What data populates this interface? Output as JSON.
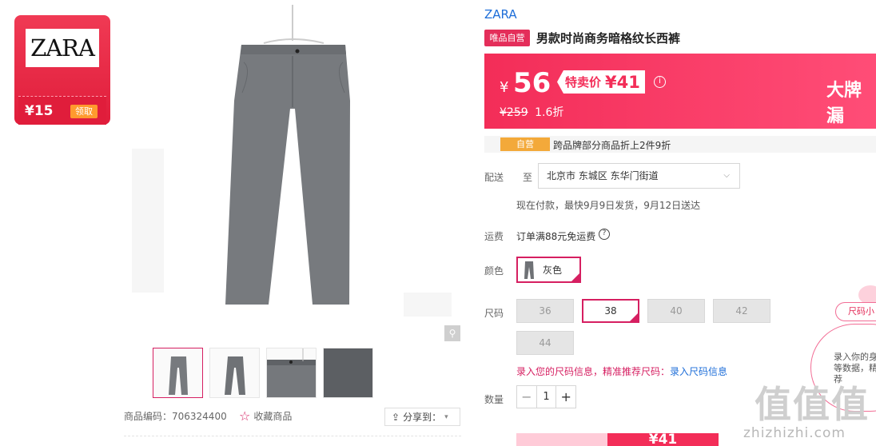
{
  "coupon": {
    "brand_logo": "ZARA",
    "amount": "¥15",
    "action": "领取"
  },
  "product": {
    "brand": "ZARA",
    "self_tag": "唯品自营",
    "title": "男款时尚商务暗格纹长西裤",
    "code_label": "商品编码：706324400",
    "favorite": "收藏商品",
    "share": "分享到：",
    "zoom_icon": "search-icon"
  },
  "price": {
    "currency": "¥",
    "value": "56",
    "special_label": "特卖价",
    "special_value": "¥41",
    "original": "¥259",
    "discount": "1.6折",
    "banner_text": "大牌漏"
  },
  "promo": {
    "tag": "自营",
    "text": "跨品牌部分商品折上2件9折"
  },
  "delivery": {
    "label": "配送",
    "to": "至",
    "address": "北京市 东城区 东华门街道",
    "estimate": "现在付款，最快9月9日发货，9月12日送达"
  },
  "shipping": {
    "label": "运费",
    "text": "订单满88元免运费"
  },
  "color": {
    "label": "颜色",
    "selected": "灰色"
  },
  "size": {
    "label": "尺码",
    "options": [
      "36",
      "38",
      "40",
      "42",
      "44"
    ],
    "selected": "38",
    "tip_prefix": "录入您的尺码信息，精准推荐尺码：",
    "tip_link": "录入尺码信息"
  },
  "quantity": {
    "label": "数量",
    "value": "1",
    "minus": "−",
    "plus": "+"
  },
  "buy": {
    "price": "¥41"
  },
  "size_assistant": {
    "pill": "尺码小",
    "text": "录入你的身 重等数据，精准推荐"
  },
  "watermark": {
    "main": "值值值",
    "sub": "zhizhizhi.com"
  },
  "colors": {
    "accent": "#f32d58",
    "brand_blue": "#1e6ed8",
    "selected_border": "#d61f61"
  }
}
